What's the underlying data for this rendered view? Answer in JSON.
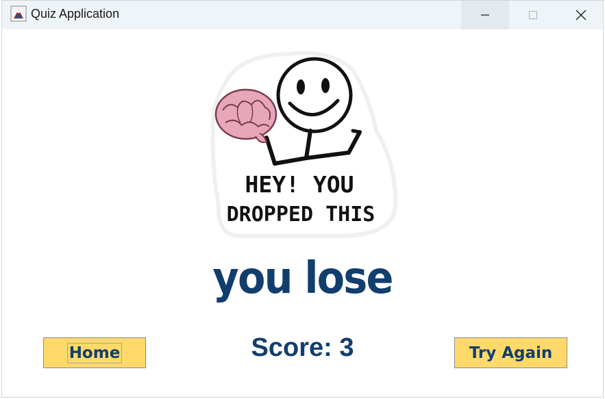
{
  "window": {
    "title": "Quiz Application",
    "app_icon": "java-cup-icon",
    "controls": [
      "minimize-icon",
      "maximize-icon",
      "close-icon"
    ]
  },
  "meme": {
    "line1": "HEY! YOU",
    "line2": "DROPPED THIS"
  },
  "result": {
    "message": "you lose",
    "score_text": "Score: 3"
  },
  "buttons": {
    "home": "Home",
    "try_again": "Try Again"
  },
  "colors": {
    "accent_text": "#123e6e",
    "button_bg": "#ffd96a",
    "titlebar_bg": "#eef4f8",
    "brain_pink": "#e8a7b9"
  }
}
